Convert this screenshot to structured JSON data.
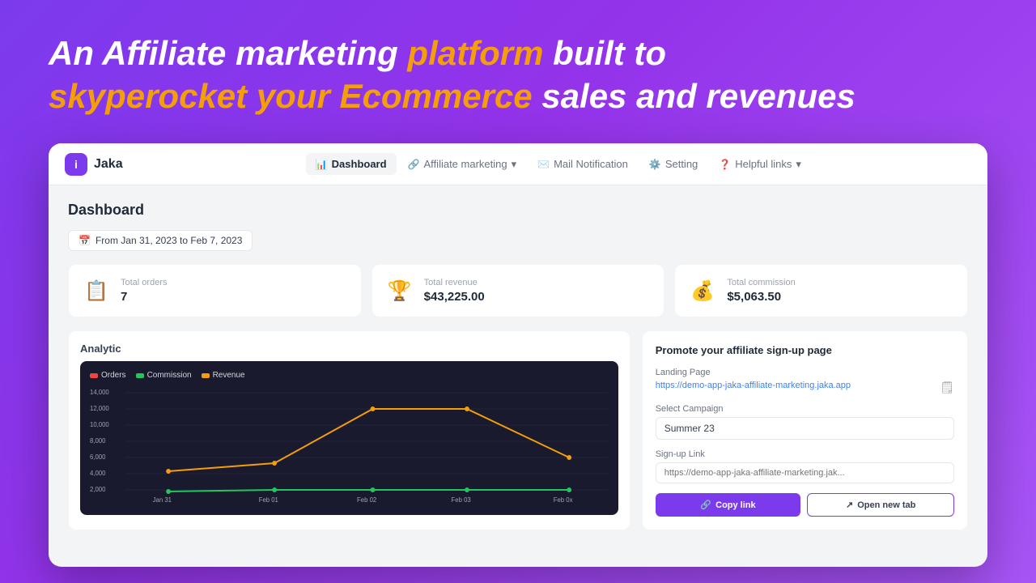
{
  "hero": {
    "line1": "An Affiliate marketing ",
    "line1_highlight": "platform",
    "line1_end": " built to",
    "line2_highlight": "skyperocket your Ecommerce",
    "line2_end": " sales and revenues"
  },
  "app": {
    "logo_letter": "i",
    "logo_name": "Jaka"
  },
  "nav": {
    "items": [
      {
        "label": "Dashboard",
        "icon": "📊",
        "active": true
      },
      {
        "label": "Affiliate marketing",
        "icon": "🔗",
        "active": false,
        "has_arrow": true
      },
      {
        "label": "Mail Notification",
        "icon": "✉️",
        "active": false
      },
      {
        "label": "Setting",
        "icon": "⚙️",
        "active": false
      },
      {
        "label": "Helpful links",
        "icon": "❓",
        "active": false,
        "has_arrow": true
      }
    ]
  },
  "dashboard": {
    "title": "Dashboard",
    "date_range": "From Jan 31, 2023 to Feb 7, 2023",
    "date_icon": "📅",
    "stats": [
      {
        "label": "Total orders",
        "value": "7",
        "icon": "📋",
        "icon_color": "#3b82f6"
      },
      {
        "label": "Total revenue",
        "value": "$43,225.00",
        "icon": "🏆",
        "icon_color": "#f59e0b"
      },
      {
        "label": "Total commission",
        "value": "$5,063.50",
        "icon": "💰",
        "icon_color": "#10b981"
      }
    ],
    "analytic_title": "Analytic",
    "chart": {
      "legend": [
        {
          "label": "Orders",
          "color": "#ef4444"
        },
        {
          "label": "Commission",
          "color": "#22c55e"
        },
        {
          "label": "Revenue",
          "color": "#f59e0b"
        }
      ],
      "x_labels": [
        "Jan 31",
        "Feb 01",
        "Feb 02",
        "Feb 03",
        "Feb 0x"
      ],
      "y_labels": [
        "14,000",
        "12,000",
        "10,000",
        "8,000",
        "6,000",
        "4,000",
        "2,000"
      ]
    }
  },
  "promote": {
    "title": "Promote your affiliate sign-up page",
    "landing_page_label": "Landing Page",
    "landing_page_url": "https://demo-app-jaka-affiliate-marketing.jaka.app",
    "select_campaign_label": "Select Campaign",
    "campaign_options": [
      "Summer 23"
    ],
    "signup_link_label": "Sign-up Link",
    "signup_link_placeholder": "https://demo-app-jaka-affiliate-marketing.jak...",
    "btn_copy": "Copy link",
    "btn_open": "Open new tab"
  }
}
